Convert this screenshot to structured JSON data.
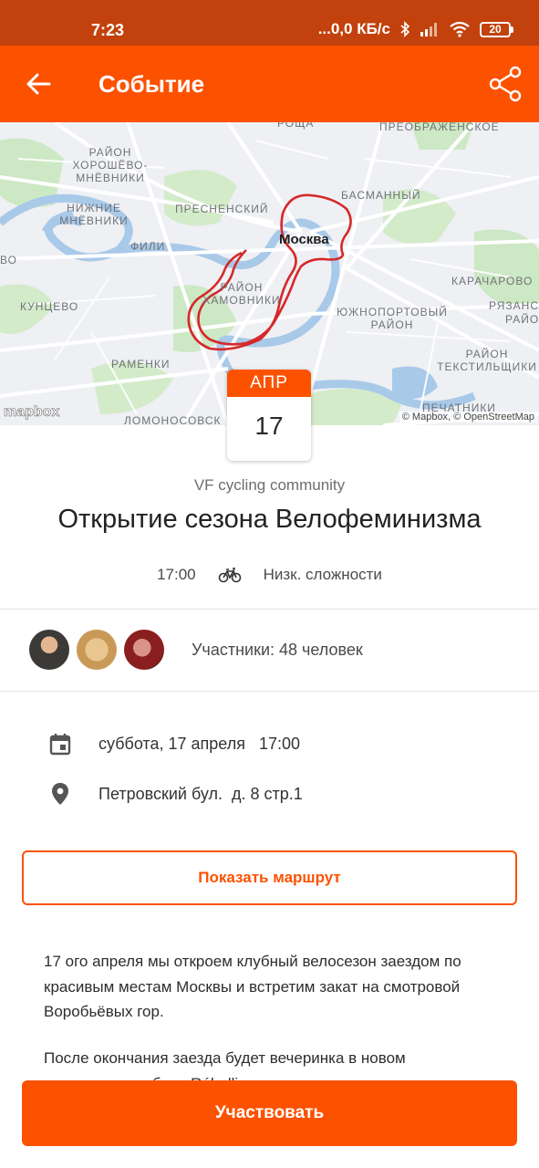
{
  "status_bar": {
    "time": "7:23",
    "network": "...0,0 КБ/с",
    "battery": "20"
  },
  "app_bar": {
    "title": "Событие",
    "back_icon": "arrow-left-icon",
    "share_icon": "share-icon"
  },
  "map": {
    "city_label": "Москва",
    "district_labels": [
      "Роща",
      "Преображенское",
      "Район Хорошёво-Мнёвники",
      "Пресненский",
      "Басманный",
      "Нижние Мнёвники",
      "Фили",
      "во",
      "Карачарово",
      "Кунцево",
      "Район Хамовники",
      "Южнопортовый район",
      "Рязанс",
      "Район",
      "Раменки",
      "Район Текстильщики",
      "Печатники",
      "Ломоносовск"
    ],
    "logo": "mapbox",
    "attribution": "© Mapbox, © OpenStreetMap"
  },
  "event": {
    "month": "АПР",
    "day": "17",
    "club": "VF cycling community",
    "title": "Открытие сезона Велофеминизма",
    "time": "17:00",
    "sport_icon": "bicycle-icon",
    "difficulty": "Низк. сложности"
  },
  "participants": {
    "label": "Участники: 48 человек",
    "avatar_count": 3
  },
  "details": {
    "date_text": "суббота, 17 апреля   17:00",
    "location_text": "Петровский бул.  д. 8 стр.1"
  },
  "buttons": {
    "show_route": "Показать маршрут",
    "join": "Участвовать"
  },
  "description": {
    "paragraph1": "17 ого апреля мы откроем клубный велосезон заездом по красивым местам Москвы и встретим закат на смотровой Воробьёвых гор.",
    "paragraph2": "После окончания заезда будет вечеринка в новом велосипедном баре Rébellion"
  },
  "colors": {
    "accent": "#fc5200",
    "status_bar": "#c2410c"
  }
}
